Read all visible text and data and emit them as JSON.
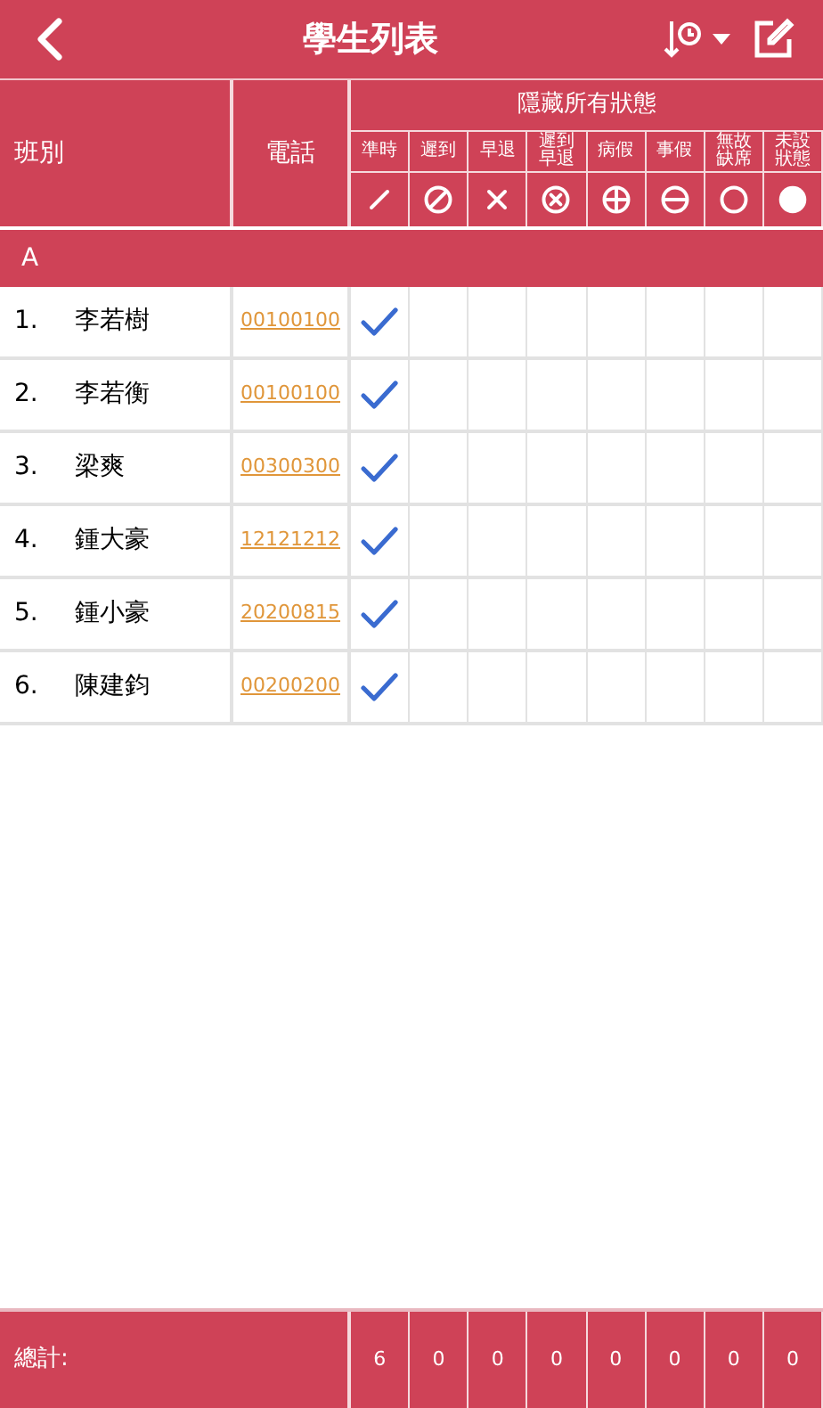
{
  "header": {
    "title": "學生列表"
  },
  "table": {
    "col_class": "班別",
    "col_phone": "電話",
    "hide_all": "隱藏所有狀態",
    "statuses": [
      {
        "label": "準時",
        "kind": "slash"
      },
      {
        "label": "遲到",
        "kind": "circle-slash"
      },
      {
        "label": "早退",
        "kind": "cross"
      },
      {
        "label": "遲到早退",
        "kind": "circle-x"
      },
      {
        "label": "病假",
        "kind": "circle-plus"
      },
      {
        "label": "事假",
        "kind": "circle-minus"
      },
      {
        "label": "無故缺席",
        "kind": "circle"
      },
      {
        "label": "未設狀態",
        "kind": "dot"
      }
    ],
    "group": "A",
    "rows": [
      {
        "no": "1.",
        "name": "李若樹",
        "phone": "00100100",
        "cells": [
          {
            "checked": true
          },
          {
            "checked": false
          },
          {
            "checked": false
          },
          {
            "checked": false
          },
          {
            "checked": false
          },
          {
            "checked": false
          },
          {
            "checked": false
          },
          {
            "checked": false
          }
        ]
      },
      {
        "no": "2.",
        "name": "李若衡",
        "phone": "00100100",
        "cells": [
          {
            "checked": true
          },
          {
            "checked": false
          },
          {
            "checked": false
          },
          {
            "checked": false
          },
          {
            "checked": false
          },
          {
            "checked": false
          },
          {
            "checked": false
          },
          {
            "checked": false
          }
        ]
      },
      {
        "no": "3.",
        "name": "梁爽",
        "phone": "00300300",
        "cells": [
          {
            "checked": true
          },
          {
            "checked": false
          },
          {
            "checked": false
          },
          {
            "checked": false
          },
          {
            "checked": false
          },
          {
            "checked": false
          },
          {
            "checked": false
          },
          {
            "checked": false
          }
        ]
      },
      {
        "no": "4.",
        "name": "鍾大豪",
        "phone": "12121212",
        "cells": [
          {
            "checked": true
          },
          {
            "checked": false
          },
          {
            "checked": false
          },
          {
            "checked": false
          },
          {
            "checked": false
          },
          {
            "checked": false
          },
          {
            "checked": false
          },
          {
            "checked": false
          }
        ]
      },
      {
        "no": "5.",
        "name": "鍾小豪",
        "phone": "20200815",
        "cells": [
          {
            "checked": true
          },
          {
            "checked": false
          },
          {
            "checked": false
          },
          {
            "checked": false
          },
          {
            "checked": false
          },
          {
            "checked": false
          },
          {
            "checked": false
          },
          {
            "checked": false
          }
        ]
      },
      {
        "no": "6.",
        "name": "陳建鈞",
        "phone": "00200200",
        "cells": [
          {
            "checked": true
          },
          {
            "checked": false
          },
          {
            "checked": false
          },
          {
            "checked": false
          },
          {
            "checked": false
          },
          {
            "checked": false
          },
          {
            "checked": false
          },
          {
            "checked": false
          }
        ]
      }
    ]
  },
  "footer": {
    "label": "總計:",
    "totals": [
      "6",
      "0",
      "0",
      "0",
      "0",
      "0",
      "0",
      "0"
    ]
  }
}
